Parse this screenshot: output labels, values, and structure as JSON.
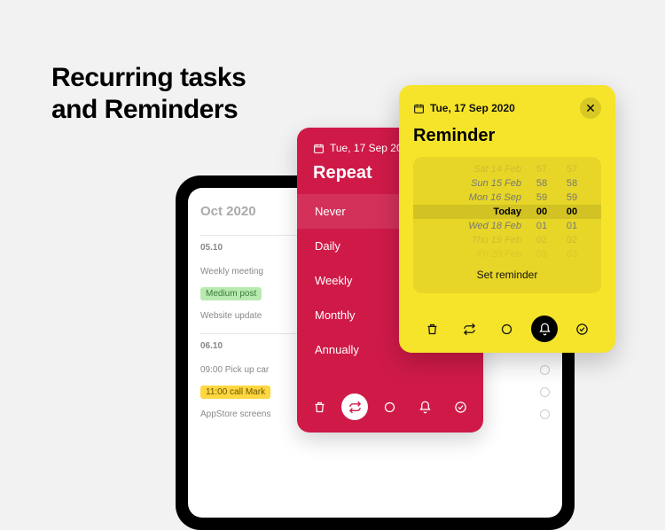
{
  "headline": {
    "line1": "Recurring tasks",
    "line2": "and Reminders"
  },
  "tablet": {
    "month": "Oct 2020",
    "sections": [
      {
        "day": "05.10",
        "tasks": [
          "Weekly meeting",
          "Medium post",
          "Website update"
        ]
      },
      {
        "day": "06.10",
        "tasks": [
          "09:00 Pick up car",
          "11:00 call Mark",
          "AppStore screens"
        ]
      }
    ]
  },
  "repeat": {
    "date": "Tue, 17 Sep 2020",
    "title": "Repeat",
    "options": [
      "Never",
      "Daily",
      "Weekly",
      "Monthly",
      "Annually"
    ]
  },
  "reminder": {
    "date": "Tue, 17 Sep 2020",
    "title": "Reminder",
    "picker": [
      {
        "d": "Sat 14 Feb",
        "h": "57",
        "m": "57"
      },
      {
        "d": "Sun 15 Feb",
        "h": "58",
        "m": "58"
      },
      {
        "d": "Mon 16 Sep",
        "h": "59",
        "m": "59"
      },
      {
        "d": "Today",
        "h": "00",
        "m": "00"
      },
      {
        "d": "Wed 18 Feb",
        "h": "01",
        "m": "01"
      },
      {
        "d": "Thu 19 Feb",
        "h": "02",
        "m": "02"
      },
      {
        "d": "Fri 20 Feb",
        "h": "03",
        "m": "03"
      }
    ],
    "setLabel": "Set reminder"
  }
}
